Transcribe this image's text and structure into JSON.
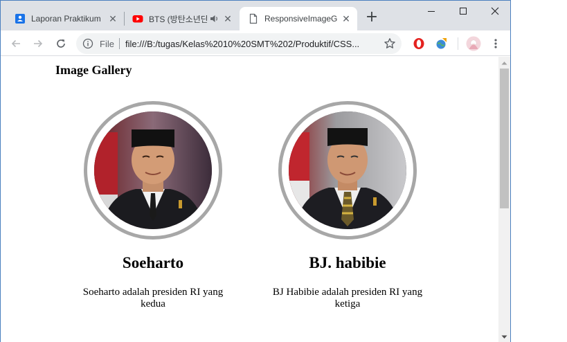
{
  "browser": {
    "tabs": [
      {
        "title": "Laporan Praktikum",
        "favicon": "docs-icon",
        "active": false
      },
      {
        "title": "BTS (방탄소년단",
        "favicon": "youtube-icon",
        "active": false,
        "audio": true
      },
      {
        "title": "ResponsiveImageG",
        "favicon": "page-icon",
        "active": true
      }
    ],
    "new_tab_label": "+",
    "address": {
      "scheme_label": "File",
      "url": "file:///B:/tugas/Kelas%2010%20SMT%202/Produktif/CSS..."
    }
  },
  "page": {
    "title": "Image Gallery",
    "people": [
      {
        "name": "Soeharto",
        "description": "Soeharto adalah presiden RI yang kedua"
      },
      {
        "name": "BJ. habibie",
        "description": "BJ Habibie adalah presiden RI yang ketiga"
      }
    ]
  },
  "colors": {
    "tabstrip": "#dee1e6",
    "ring": "#a7a7a7",
    "window_border": "#4a7fbf"
  }
}
